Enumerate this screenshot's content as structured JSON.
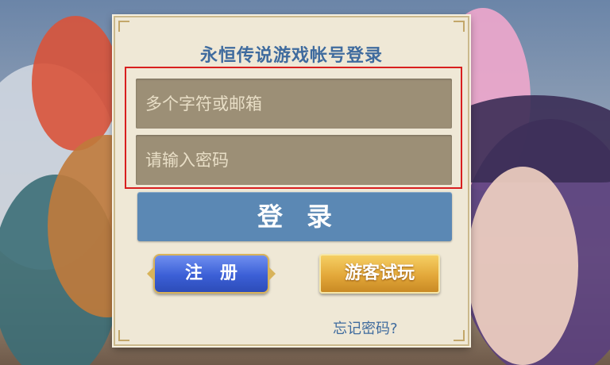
{
  "dialog": {
    "title": "永恒传说游戏帐号登录",
    "username_placeholder": "多个字符或邮箱",
    "password_placeholder": "请输入密码",
    "login_label": "登录",
    "register_label": "注册",
    "guest_label": "游客试玩",
    "forgot_label": "忘记密码?"
  },
  "colors": {
    "title": "#3f6b9e",
    "input_bg": "#9c8f76",
    "login_button": "#5b88b4",
    "register_button": "#3b5fd6",
    "guest_button": "#e3a83a",
    "highlight_border": "#d81f1f"
  }
}
